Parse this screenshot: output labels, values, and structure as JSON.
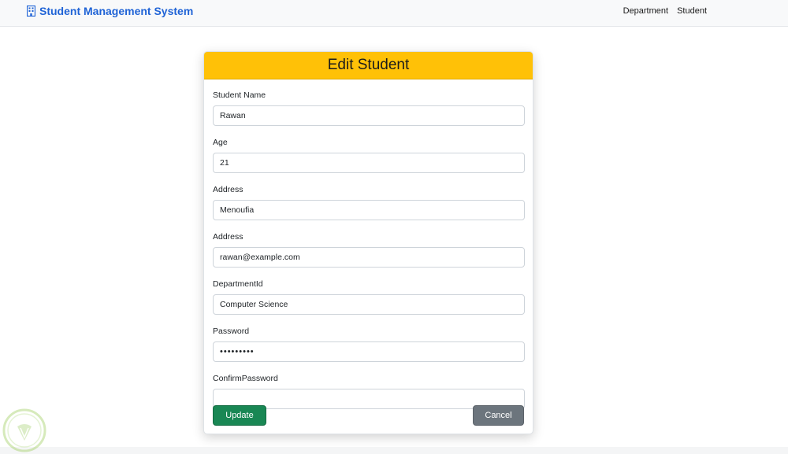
{
  "navbar": {
    "brand_icon": "building-icon",
    "brand": "Student Management System",
    "links": [
      {
        "label": "Department"
      },
      {
        "label": "Student"
      }
    ]
  },
  "form": {
    "title": "Edit Student",
    "fields": [
      {
        "label": "Student Name",
        "value": "Rawan",
        "type": "text"
      },
      {
        "label": "Age",
        "value": "21",
        "type": "text"
      },
      {
        "label": "Address",
        "value": "Menoufia",
        "type": "text"
      },
      {
        "label": "Address",
        "value": "rawan@example.com",
        "type": "text"
      },
      {
        "label": "DepartmentId",
        "value": "Computer Science",
        "type": "text"
      },
      {
        "label": "Password",
        "value": "•••••••••",
        "type": "password"
      },
      {
        "label": "ConfirmPassword",
        "value": "",
        "type": "password"
      }
    ],
    "update_label": "Update",
    "cancel_label": "Cancel"
  },
  "colors": {
    "brand": "#1f63d6",
    "header": "#ffc107",
    "update": "#198754",
    "cancel": "#6c757d"
  },
  "watermark_icon": "leaf-logo-icon"
}
